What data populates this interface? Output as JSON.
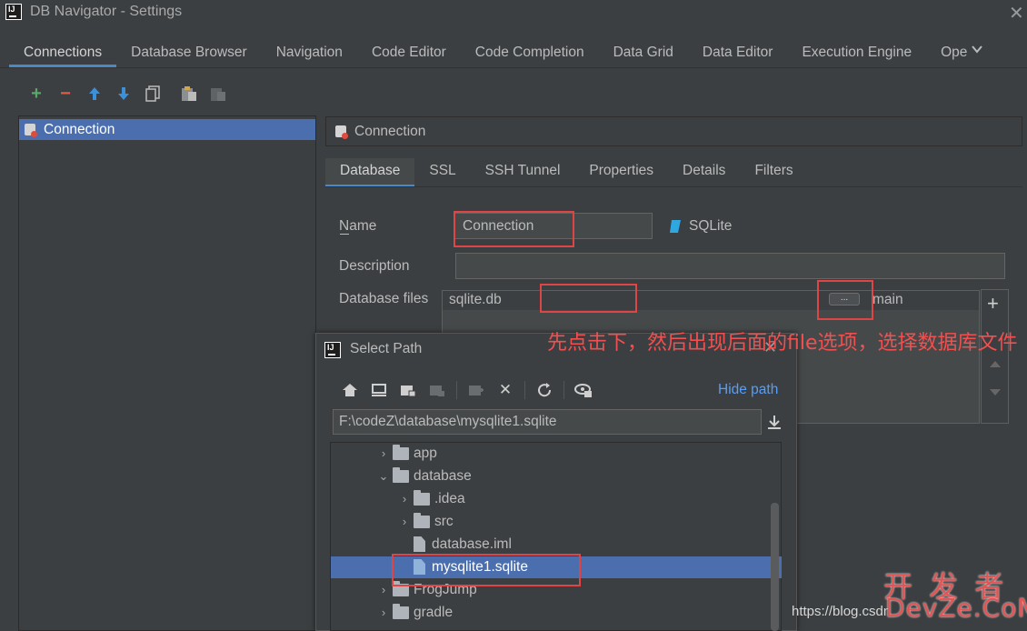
{
  "window": {
    "title": "DB Navigator - Settings"
  },
  "tabs": [
    "Connections",
    "Database Browser",
    "Navigation",
    "Code Editor",
    "Code Completion",
    "Data Grid",
    "Data Editor",
    "Execution Engine",
    "Ope"
  ],
  "sidebar": {
    "items": [
      {
        "label": "Connection"
      }
    ]
  },
  "panel": {
    "header_title": "Connection",
    "subtabs": [
      "Database",
      "SSL",
      "SSH Tunnel",
      "Properties",
      "Details",
      "Filters"
    ],
    "name_label": "Name",
    "name_value": "Connection",
    "db_type": "SQLite",
    "description_label": "Description",
    "description_value": "",
    "db_files_label": "Database files",
    "files": [
      {
        "path": "sqlite.db",
        "schema": "main"
      }
    ],
    "browse_button": "...",
    "add_symbol": "+"
  },
  "annotation": {
    "text": "先点击下，然后出现后面的file选项，选择数据库文件"
  },
  "dialog": {
    "title": "Select Path",
    "hide_path": "Hide path",
    "path_value": "F:\\codeZ\\database\\mysqlite1.sqlite",
    "tree": [
      {
        "label": "app",
        "type": "folder",
        "indent": 0,
        "chevron": "›"
      },
      {
        "label": "database",
        "type": "folder",
        "indent": 0,
        "chevron": "⌄"
      },
      {
        "label": ".idea",
        "type": "folder",
        "indent": 1,
        "chevron": "›"
      },
      {
        "label": "src",
        "type": "folder",
        "indent": 1,
        "chevron": "›"
      },
      {
        "label": "database.iml",
        "type": "file",
        "indent": 1,
        "chevron": ""
      },
      {
        "label": "mysqlite1.sqlite",
        "type": "file",
        "indent": 1,
        "chevron": "",
        "selected": true
      },
      {
        "label": "FrogJump",
        "type": "folder",
        "indent": 0,
        "chevron": "›"
      },
      {
        "label": "gradle",
        "type": "folder",
        "indent": 0,
        "chevron": "›"
      }
    ]
  },
  "watermark": {
    "url": "https://blog.csdn",
    "brand_cn": "开 发 者",
    "brand_en": "DevZe.CoM"
  },
  "colors": {
    "accent": "#4a88c7",
    "selection": "#4b6eaf",
    "annotation": "#f25050",
    "link": "#589df6"
  }
}
